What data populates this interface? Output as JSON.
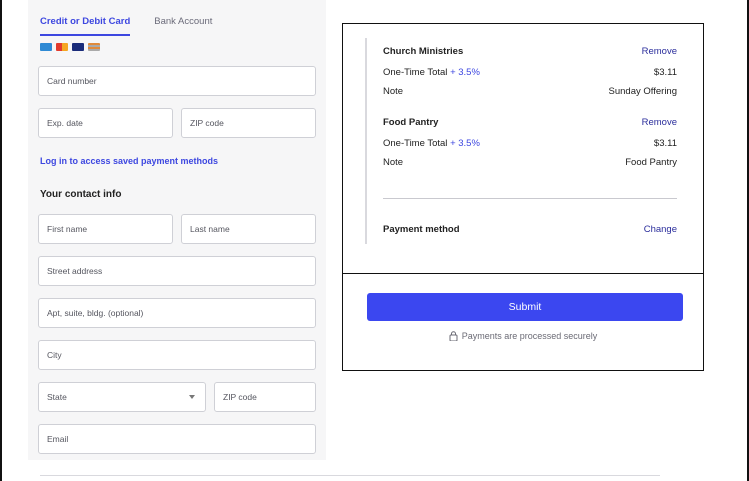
{
  "tabs": [
    {
      "label": "Credit or Debit Card",
      "active": true
    },
    {
      "label": "Bank Account",
      "active": false
    }
  ],
  "card_icons": [
    "amex-icon",
    "mastercard-icon",
    "visa-icon",
    "discover-icon"
  ],
  "payment_fields": {
    "card_number": "Card number",
    "exp_date": "Exp. date",
    "zip_code": "ZIP code"
  },
  "saved_link": "Log in to access saved payment methods",
  "contact": {
    "title": "Your contact info",
    "first_name": "First name",
    "last_name": "Last name",
    "street": "Street address",
    "apt": "Apt, suite, bldg. (optional)",
    "city": "City",
    "state": "State",
    "zip": "ZIP code",
    "email": "Email"
  },
  "summary": {
    "items": [
      {
        "name": "Church Ministries",
        "remove": "Remove",
        "total_label": "One-Time Total",
        "fee": "+ 3.5%",
        "amount": "$3.11",
        "note_label": "Note",
        "note": "Sunday Offering"
      },
      {
        "name": "Food Pantry",
        "remove": "Remove",
        "total_label": "One-Time Total",
        "fee": "+ 3.5%",
        "amount": "$3.11",
        "note_label": "Note",
        "note": "Food Pantry"
      }
    ],
    "payment_method_label": "Payment method",
    "change": "Change",
    "submit": "Submit",
    "secure_note": "Payments are processed securely"
  },
  "colors": {
    "accent": "#3d47e0",
    "submit": "#3b47f0",
    "panel": "#f6f6f7"
  }
}
